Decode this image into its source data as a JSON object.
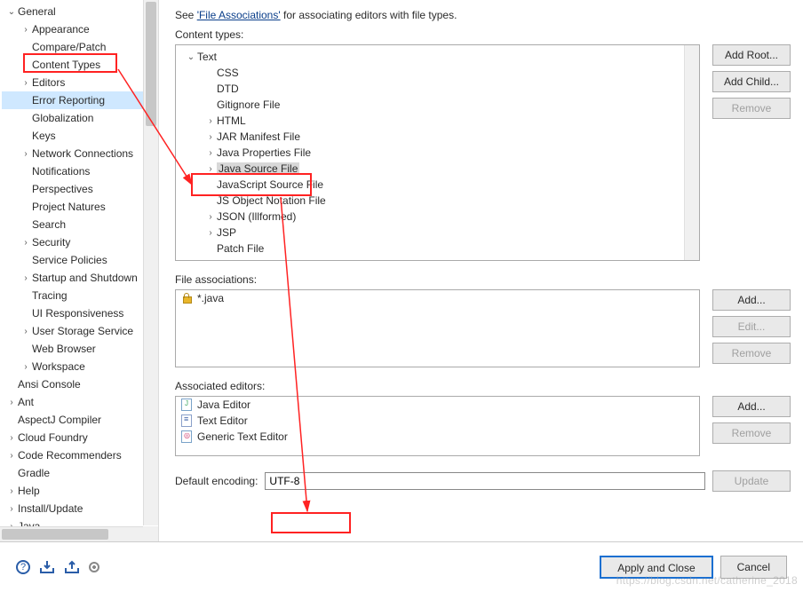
{
  "intro": {
    "prefix": "See ",
    "link": "'File Associations'",
    "suffix": " for associating editors with file types."
  },
  "labels": {
    "content_types": "Content types:",
    "file_associations": "File associations:",
    "associated_editors": "Associated editors:",
    "default_encoding": "Default encoding:"
  },
  "buttons": {
    "add_root": "Add Root...",
    "add_child": "Add Child...",
    "remove": "Remove",
    "add": "Add...",
    "edit": "Edit...",
    "update": "Update",
    "apply_close": "Apply and Close",
    "cancel": "Cancel"
  },
  "sidebar": {
    "items": [
      {
        "label": "General",
        "expand": "v",
        "ind": 0
      },
      {
        "label": "Appearance",
        "expand": ">",
        "ind": 1
      },
      {
        "label": "Compare/Patch",
        "expand": "",
        "ind": 1
      },
      {
        "label": "Content Types",
        "expand": "",
        "ind": 1,
        "hl": true
      },
      {
        "label": "Editors",
        "expand": ">",
        "ind": 1
      },
      {
        "label": "Error Reporting",
        "expand": "",
        "ind": 1,
        "sel": true
      },
      {
        "label": "Globalization",
        "expand": "",
        "ind": 1
      },
      {
        "label": "Keys",
        "expand": "",
        "ind": 1
      },
      {
        "label": "Network Connections",
        "expand": ">",
        "ind": 1
      },
      {
        "label": "Notifications",
        "expand": "",
        "ind": 1
      },
      {
        "label": "Perspectives",
        "expand": "",
        "ind": 1
      },
      {
        "label": "Project Natures",
        "expand": "",
        "ind": 1
      },
      {
        "label": "Search",
        "expand": "",
        "ind": 1
      },
      {
        "label": "Security",
        "expand": ">",
        "ind": 1
      },
      {
        "label": "Service Policies",
        "expand": "",
        "ind": 1
      },
      {
        "label": "Startup and Shutdown",
        "expand": ">",
        "ind": 1
      },
      {
        "label": "Tracing",
        "expand": "",
        "ind": 1
      },
      {
        "label": "UI Responsiveness",
        "expand": "",
        "ind": 1
      },
      {
        "label": "User Storage Service",
        "expand": ">",
        "ind": 1
      },
      {
        "label": "Web Browser",
        "expand": "",
        "ind": 1
      },
      {
        "label": "Workspace",
        "expand": ">",
        "ind": 1
      },
      {
        "label": "Ansi Console",
        "expand": "",
        "ind": 0
      },
      {
        "label": "Ant",
        "expand": ">",
        "ind": 0
      },
      {
        "label": "AspectJ Compiler",
        "expand": "",
        "ind": 0
      },
      {
        "label": "Cloud Foundry",
        "expand": ">",
        "ind": 0
      },
      {
        "label": "Code Recommenders",
        "expand": ">",
        "ind": 0
      },
      {
        "label": "Gradle",
        "expand": "",
        "ind": 0
      },
      {
        "label": "Help",
        "expand": ">",
        "ind": 0
      },
      {
        "label": "Install/Update",
        "expand": ">",
        "ind": 0
      },
      {
        "label": "Java",
        "expand": ">",
        "ind": 0
      }
    ]
  },
  "content_tree": {
    "items": [
      {
        "label": "Text",
        "expand": "v",
        "ind": 0
      },
      {
        "label": "CSS",
        "expand": "",
        "ind": 1
      },
      {
        "label": "DTD",
        "expand": "",
        "ind": 1
      },
      {
        "label": "Gitignore File",
        "expand": "",
        "ind": 1
      },
      {
        "label": "HTML",
        "expand": ">",
        "ind": 1
      },
      {
        "label": "JAR Manifest File",
        "expand": ">",
        "ind": 1
      },
      {
        "label": "Java Properties File",
        "expand": ">",
        "ind": 1
      },
      {
        "label": "Java Source File",
        "expand": ">",
        "ind": 1,
        "sel": true,
        "hl": true
      },
      {
        "label": "JavaScript Source File",
        "expand": "",
        "ind": 1
      },
      {
        "label": "JS Object Notation File",
        "expand": "",
        "ind": 1
      },
      {
        "label": "JSON (Illformed)",
        "expand": ">",
        "ind": 1
      },
      {
        "label": "JSP",
        "expand": ">",
        "ind": 1
      },
      {
        "label": "Patch File",
        "expand": "",
        "ind": 1
      }
    ]
  },
  "file_assoc": {
    "items": [
      "*.java"
    ]
  },
  "assoc_editors": {
    "items": [
      {
        "label": "Java Editor",
        "icon": "j"
      },
      {
        "label": "Text Editor",
        "icon": "t"
      },
      {
        "label": "Generic Text Editor",
        "icon": "g"
      }
    ]
  },
  "encoding": {
    "value": "UTF-8"
  },
  "watermark": "https://blog.csdn.net/catherine_2018"
}
